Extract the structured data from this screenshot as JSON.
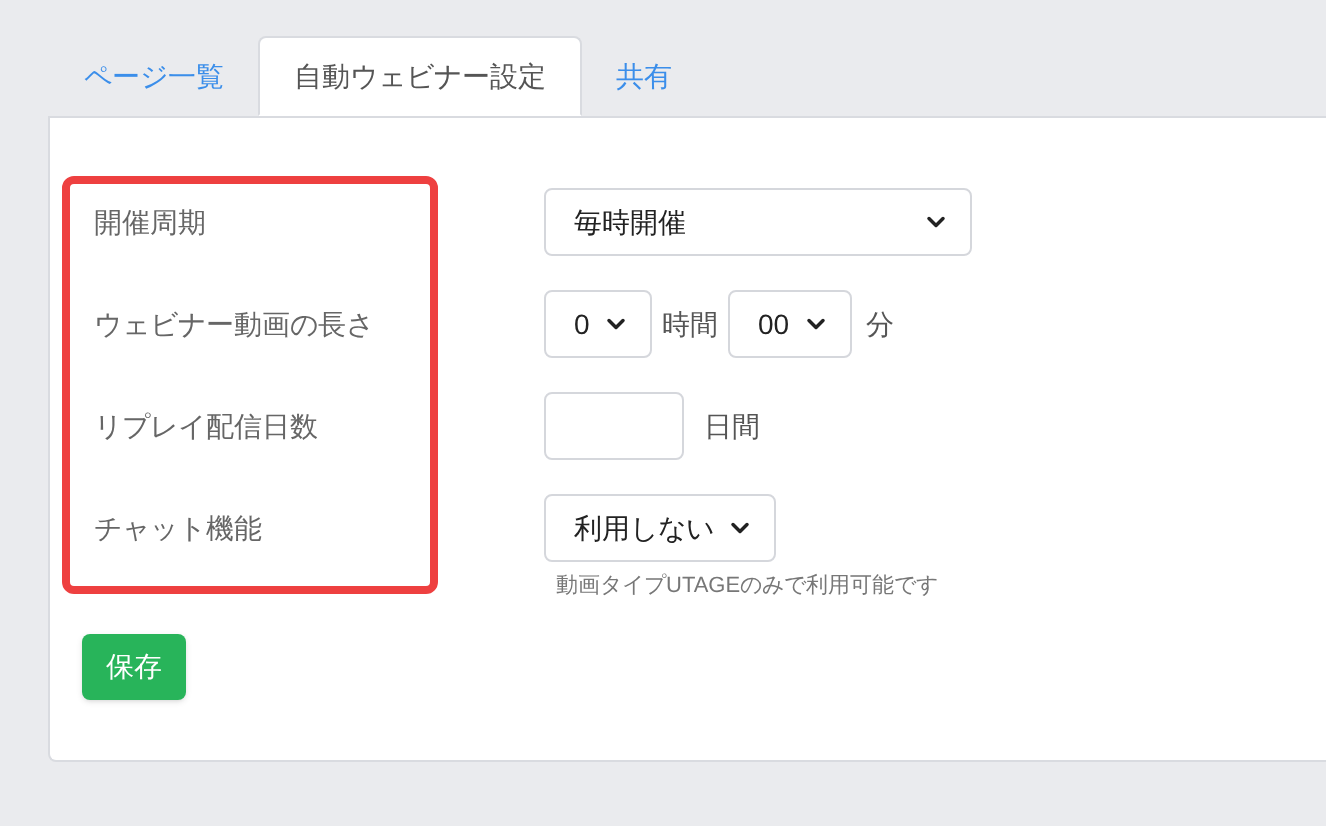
{
  "tabs": [
    {
      "label": "ページ一覧",
      "selected": false
    },
    {
      "label": "自動ウェビナー設定",
      "selected": true
    },
    {
      "label": "共有",
      "selected": false
    }
  ],
  "form": {
    "labels_highlighted": true,
    "rows": [
      {
        "kind": "select",
        "label": "開催周期",
        "value": "毎時開催"
      },
      {
        "kind": "duration",
        "label": "ウェビナー動画の長さ",
        "hours": "0",
        "hours_unit": "時間",
        "minutes": "00",
        "minutes_unit": "分"
      },
      {
        "kind": "number",
        "label": "リプレイ配信日数",
        "unit": "日間"
      },
      {
        "kind": "select_short",
        "label": "チャット機能",
        "value": "利用しない",
        "note": "動画タイプUTAGEのみで利用可能です"
      }
    ]
  },
  "save_button": "保存"
}
